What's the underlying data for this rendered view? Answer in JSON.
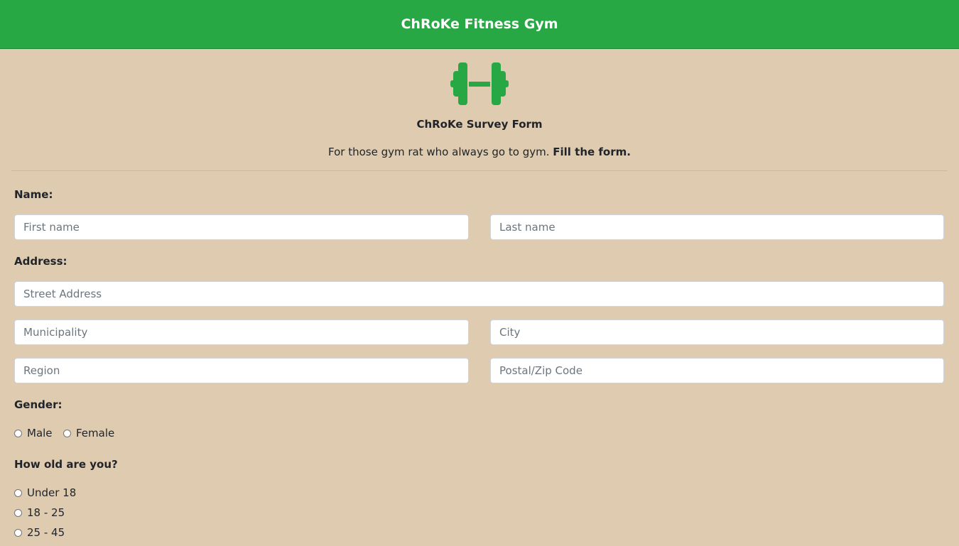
{
  "header": {
    "title": "ChRoKe Fitness Gym",
    "accent_color": "#28a745"
  },
  "hero": {
    "logo_icon": "dumbbell-icon",
    "form_title": "ChRoKe Survey Form",
    "tagline_text": "For those gym rat who always go to gym.",
    "tagline_bold": "Fill the form."
  },
  "form": {
    "name_label": "Name:",
    "first_name_placeholder": "First name",
    "last_name_placeholder": "Last name",
    "address_label": "Address:",
    "street_placeholder": "Street Address",
    "municipality_placeholder": "Municipality",
    "city_placeholder": "City",
    "region_placeholder": "Region",
    "postal_placeholder": "Postal/Zip Code",
    "gender_label": "Gender:",
    "gender_options": [
      "Male",
      "Female"
    ],
    "age_label": "How old are you?",
    "age_options": [
      "Under 18",
      "18 - 25",
      "25 - 45"
    ]
  }
}
